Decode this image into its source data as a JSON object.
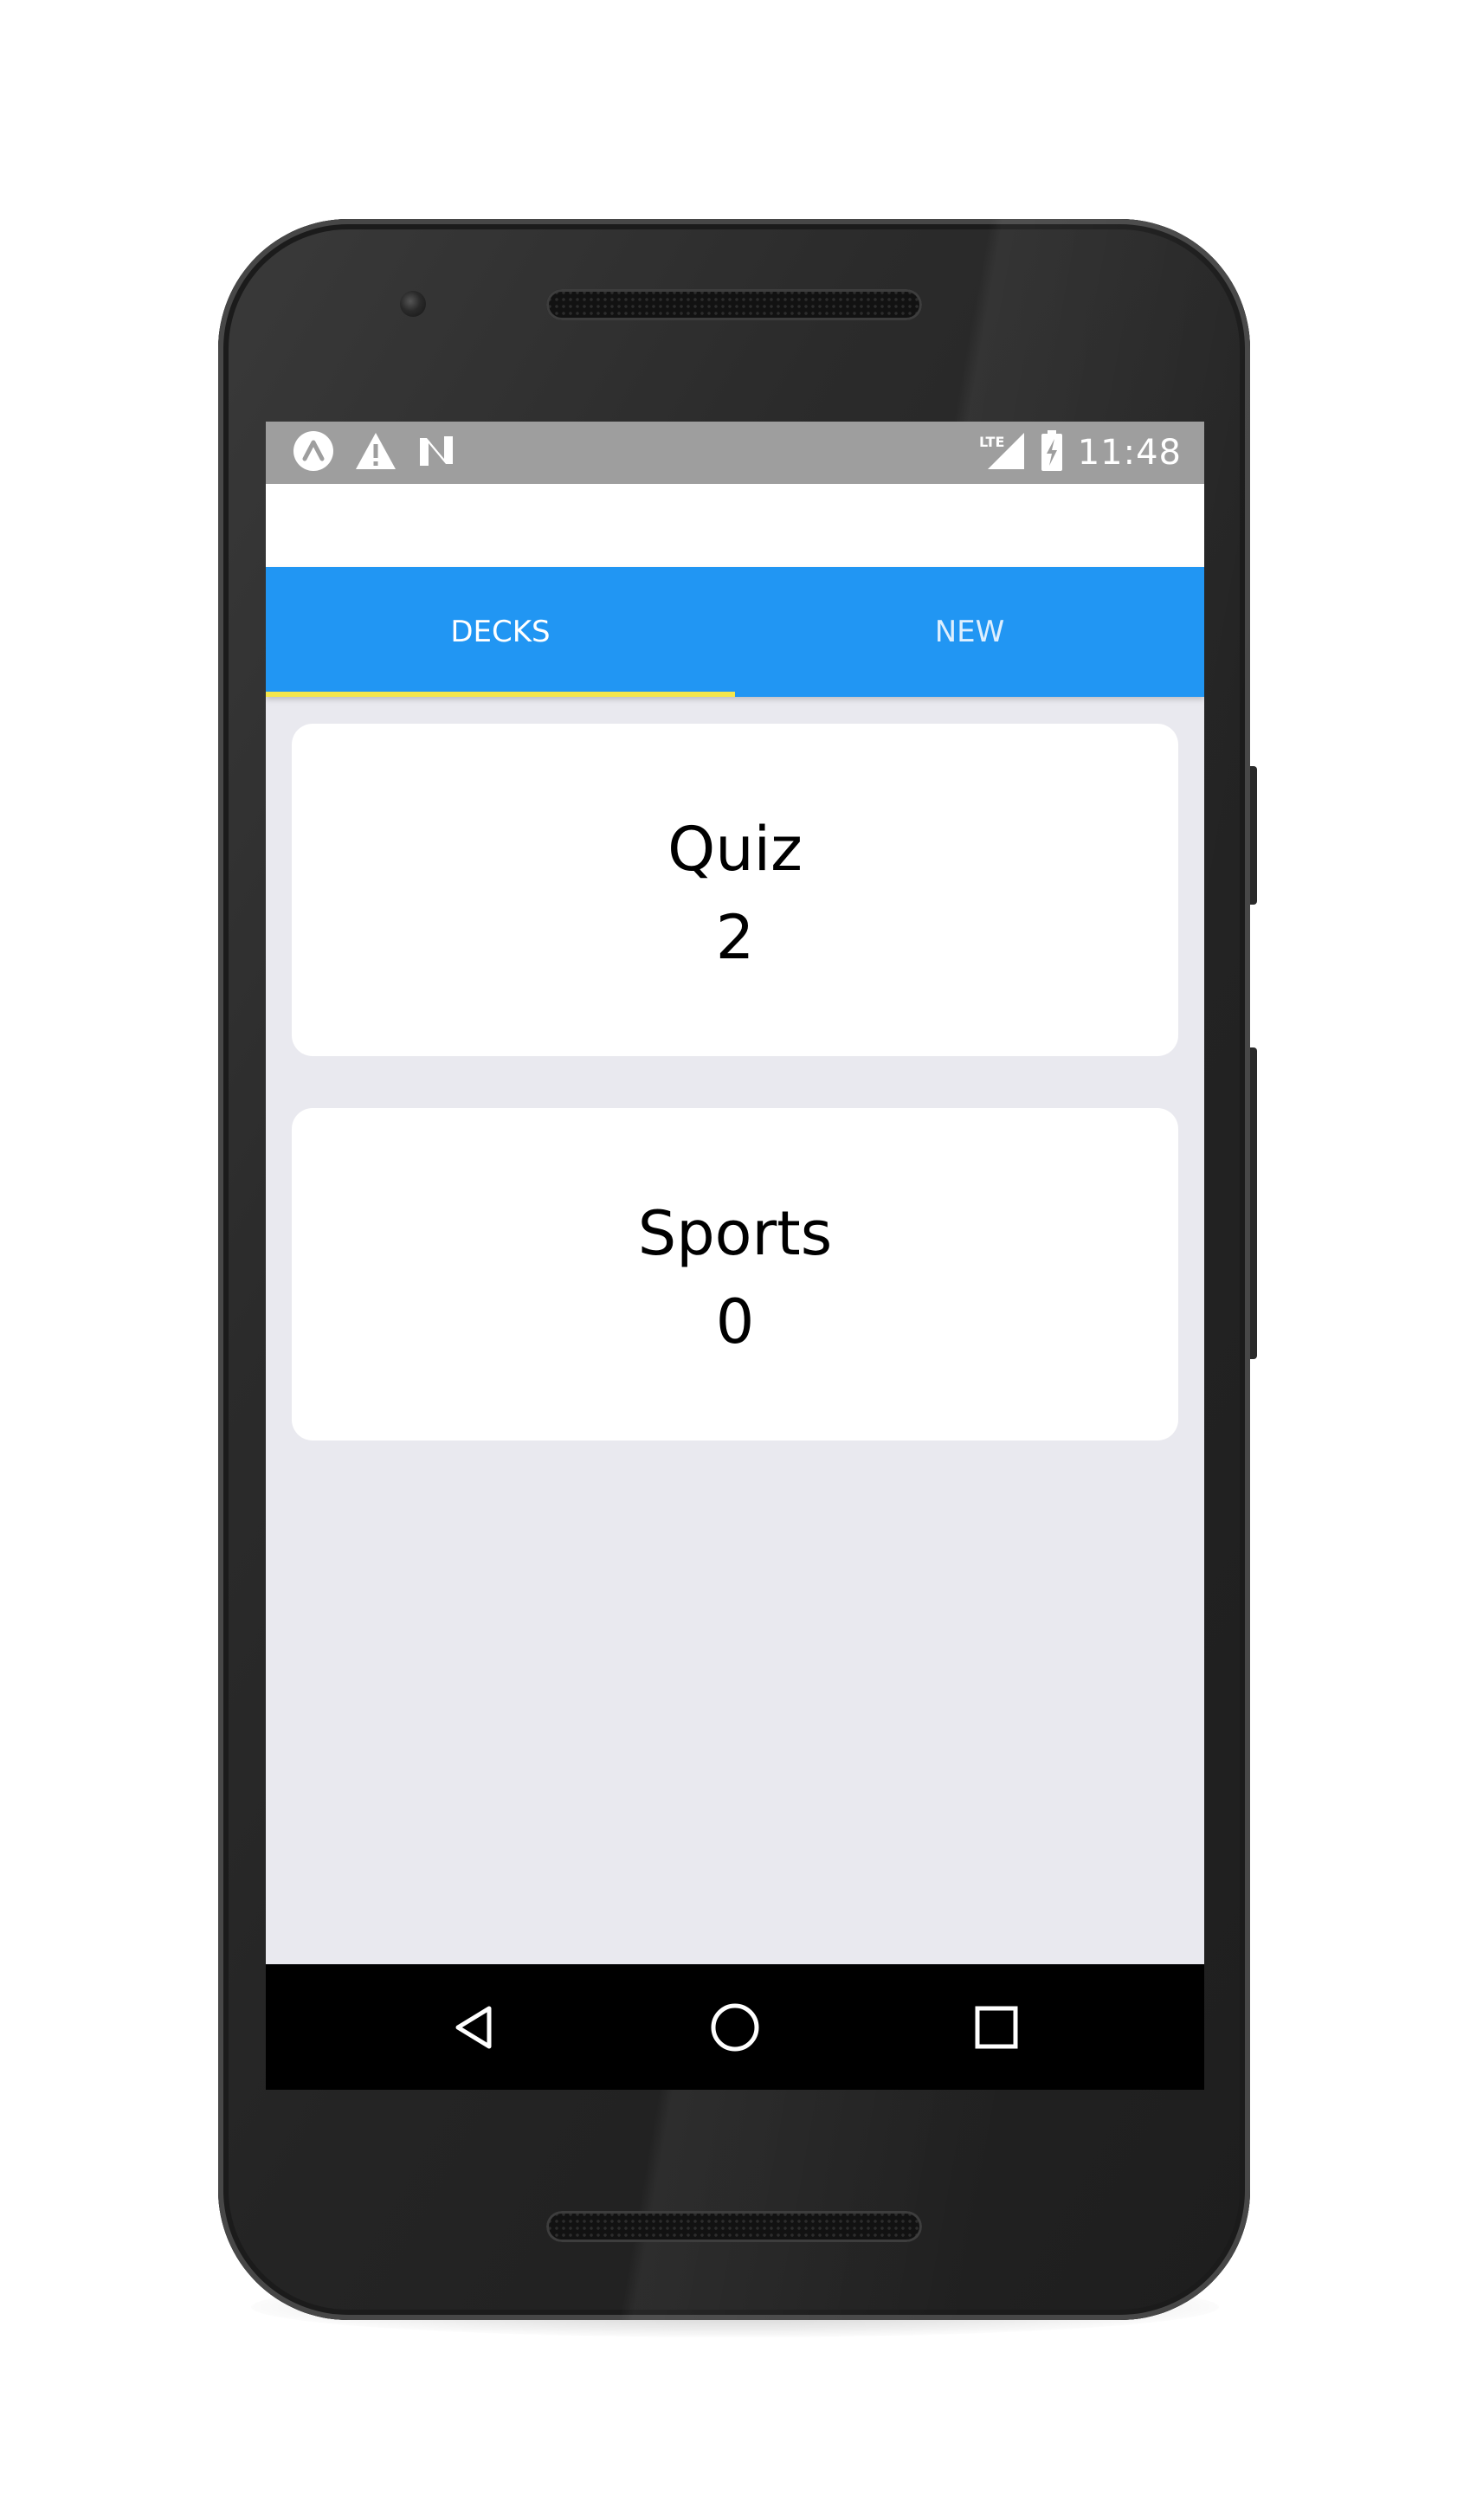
{
  "status_bar": {
    "time": "11:48",
    "left_icons": [
      "expo-icon",
      "warning-icon",
      "n-notification-icon"
    ],
    "right_icons": [
      "lte-signal-icon",
      "battery-charging-icon"
    ],
    "lte_label": "LTE"
  },
  "tabs": [
    {
      "label": "DECKS",
      "active": true
    },
    {
      "label": "NEW",
      "active": false
    }
  ],
  "decks": [
    {
      "title": "Quiz",
      "count": "2"
    },
    {
      "title": "Sports",
      "count": "0"
    }
  ],
  "nav_bar": {
    "buttons": [
      "back-icon",
      "home-icon",
      "recents-icon"
    ]
  },
  "colors": {
    "tab_bar": "#2196f3",
    "tab_indicator": "#f5e64b",
    "status_bar": "#9e9e9e",
    "screen_background": "#e9e9ef",
    "card_background": "#ffffff"
  }
}
